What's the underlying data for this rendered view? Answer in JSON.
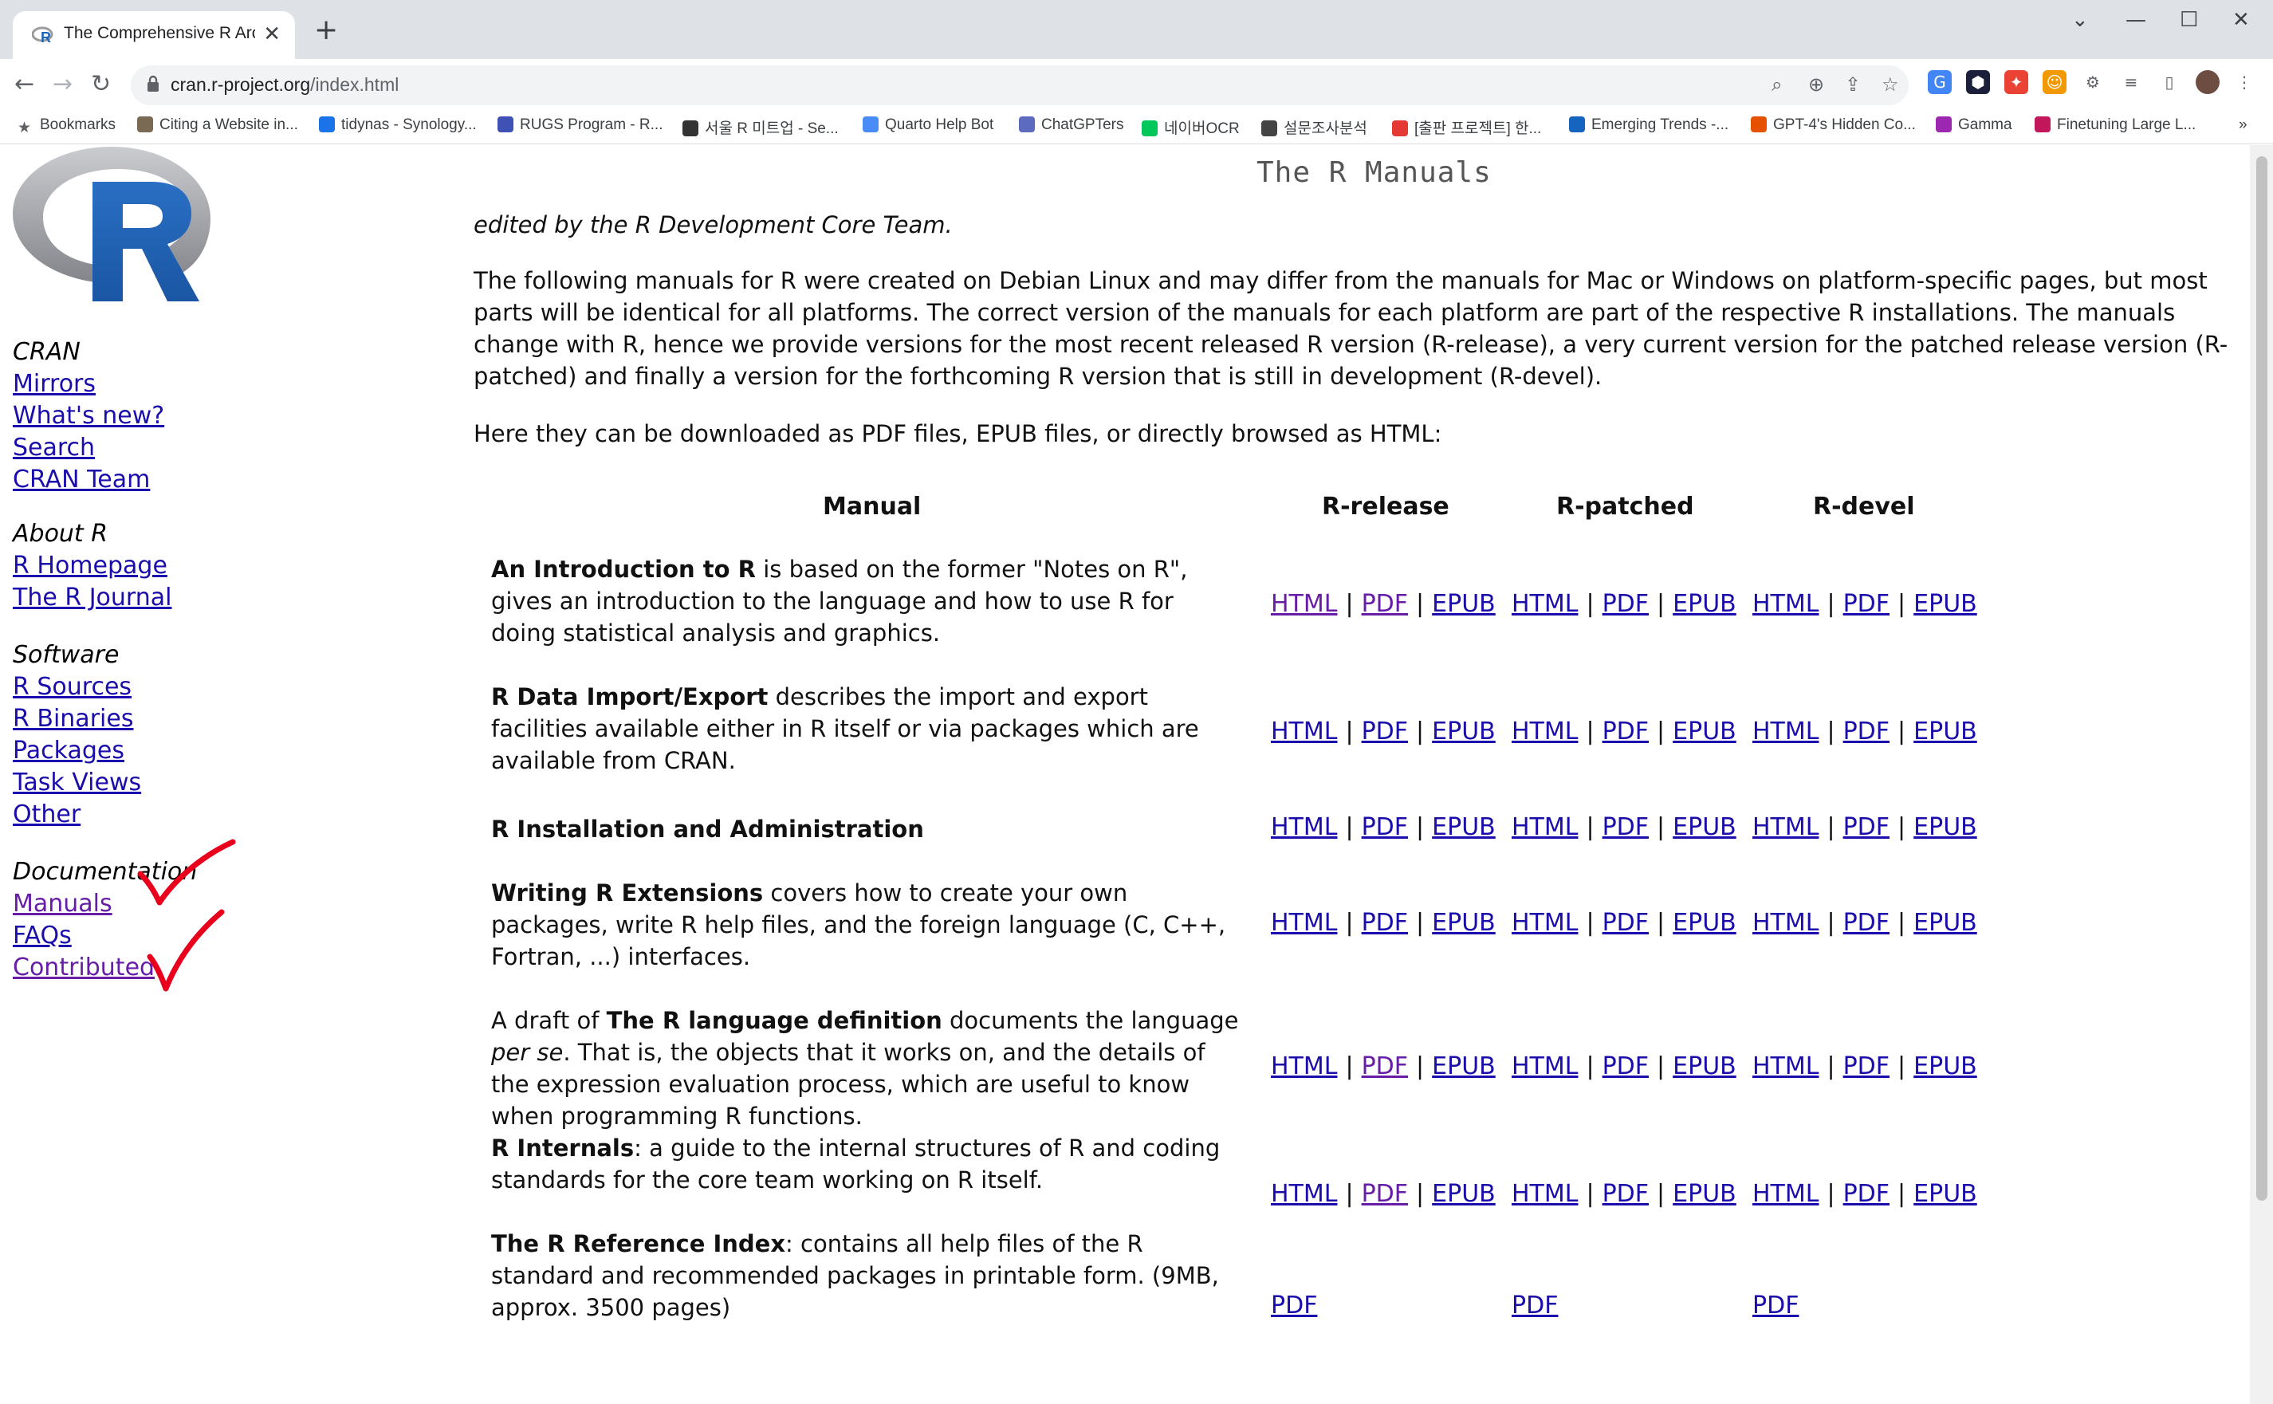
{
  "browser": {
    "tab_title": "The Comprehensive R Archive N",
    "url_domain": "cran.r-project.org",
    "url_path": "/index.html",
    "bookmarks": [
      "Bookmarks",
      "Citing a Website in...",
      "tidynas - Synology...",
      "RUGS Program - R...",
      "서울 R 미트업 - Se...",
      "Quarto Help Bot",
      "ChatGPTers",
      "네이버OCR",
      "설문조사분석",
      "[출판 프로젝트] 한...",
      "Emerging Trends -...",
      "GPT-4's Hidden Co...",
      "Gamma",
      "Finetuning Large L..."
    ]
  },
  "sidebar": {
    "sections": [
      {
        "heading": "CRAN",
        "links": [
          "Mirrors",
          "What's new?",
          "Search",
          "CRAN Team"
        ]
      },
      {
        "heading": "About R",
        "links": [
          "R Homepage",
          "The R Journal"
        ]
      },
      {
        "heading": "Software",
        "links": [
          "R Sources",
          "R Binaries",
          "Packages",
          "Task Views",
          "Other"
        ]
      },
      {
        "heading": "Documentation",
        "links": [
          "Manuals",
          "FAQs",
          "Contributed"
        ]
      }
    ]
  },
  "main": {
    "title": "The R Manuals",
    "edited_by": "edited by the R Development Core Team.",
    "intro": "The following manuals for R were created on Debian Linux and may differ from the manuals for Mac or Windows on platform-specific pages, but most parts will be identical for all platforms. The correct version of the manuals for each platform are part of the respective R installations. The manuals change with R, hence we provide versions for the most recent released R version (R-release), a very current version for the patched release version (R-patched) and finally a version for the forthcoming R version that is still in development (R-devel).",
    "download_note": "Here they can be downloaded as PDF files, EPUB files, or directly browsed as HTML:",
    "columns": [
      "Manual",
      "R-release",
      "R-patched",
      "R-devel"
    ],
    "link_labels": {
      "html": "HTML",
      "pdf": "PDF",
      "epub": "EPUB",
      "sep": "|"
    },
    "manuals": [
      {
        "pre": "",
        "bold": "An Introduction to R",
        "rest": " is based on the former \"Notes on R\", gives an introduction to the language and how to use R for doing statistical analysis and graphics."
      },
      {
        "pre": "",
        "bold": "R Data Import/Export",
        "rest": " describes the import and export facilities available either in R itself or via packages which are available from CRAN."
      },
      {
        "pre": "",
        "bold": "R Installation and Administration",
        "rest": ""
      },
      {
        "pre": "",
        "bold": "Writing R Extensions",
        "rest": " covers how to create your own packages, write R help files, and the foreign language (C, C++, Fortran, ...) interfaces."
      },
      {
        "pre": "A draft of ",
        "bold": "The R language definition",
        "rest": " documents the language ",
        "em": "per se",
        "tail": ". That is, the objects that it works on, and the details of the expression evaluation process, which are useful to know when programming R functions."
      },
      {
        "pre": "",
        "bold": "R Internals",
        "rest": ": a guide to the internal structures of R and coding standards for the core team working on R itself."
      },
      {
        "pre": "",
        "bold": "The R Reference Index",
        "rest": ": contains all help files of the R standard and recommended packages in printable form. (9MB, approx. 3500 pages)"
      }
    ]
  },
  "colors": {
    "link": "#1a0dab",
    "visited": "#681da8",
    "logo_blue": "#1f65b7",
    "annotation_red": "#e8001c"
  }
}
